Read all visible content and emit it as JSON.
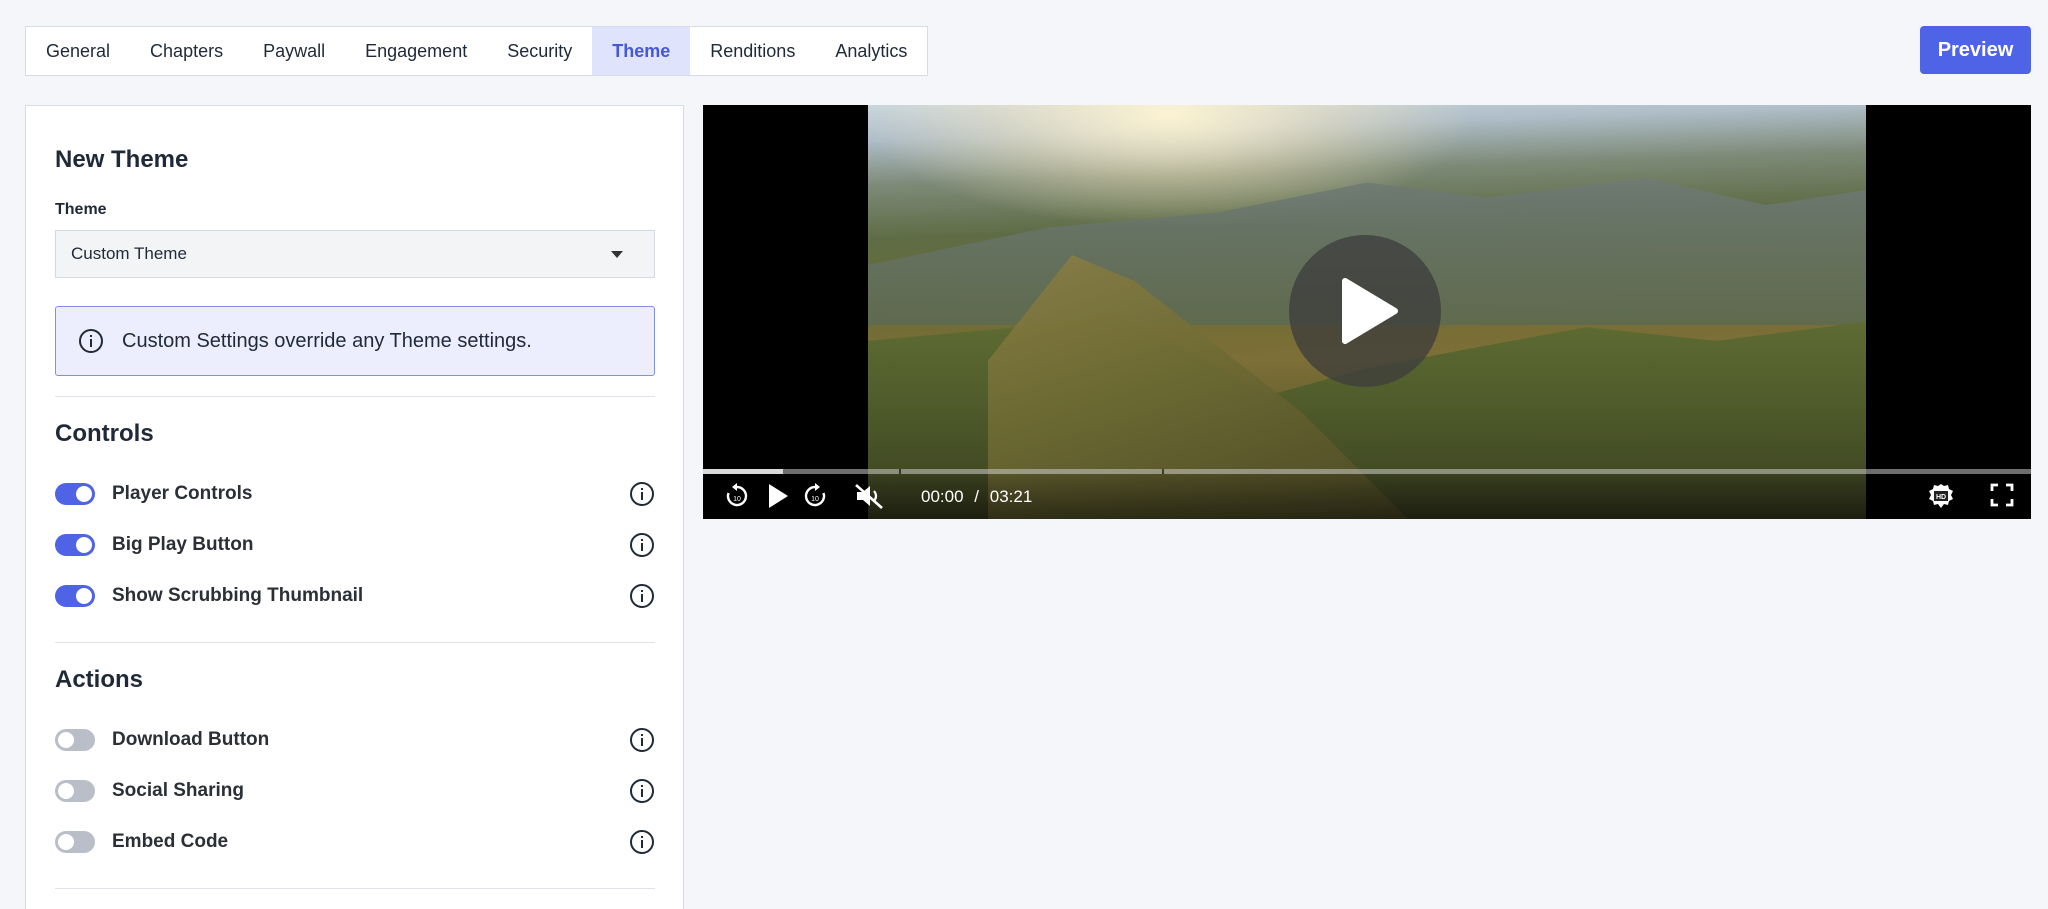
{
  "tabs": [
    {
      "label": "General"
    },
    {
      "label": "Chapters"
    },
    {
      "label": "Paywall"
    },
    {
      "label": "Engagement"
    },
    {
      "label": "Security"
    },
    {
      "label": "Theme",
      "active": true
    },
    {
      "label": "Renditions"
    },
    {
      "label": "Analytics"
    }
  ],
  "header": {
    "preview_label": "Preview"
  },
  "panel": {
    "title": "New Theme",
    "theme_label": "Theme",
    "theme_value": "Custom Theme",
    "info_text": "Custom Settings override any Theme settings.",
    "controls": {
      "title": "Controls",
      "items": [
        {
          "label": "Player Controls",
          "enabled": true
        },
        {
          "label": "Big Play Button",
          "enabled": true
        },
        {
          "label": "Show Scrubbing Thumbnail",
          "enabled": true
        }
      ]
    },
    "actions": {
      "title": "Actions",
      "items": [
        {
          "label": "Download Button",
          "enabled": false
        },
        {
          "label": "Social Sharing",
          "enabled": false
        },
        {
          "label": "Embed Code",
          "enabled": false
        }
      ]
    }
  },
  "player": {
    "current_time": "00:00",
    "separator": "/",
    "duration": "03:21",
    "buffered_fraction": 0.06
  },
  "colors": {
    "accent": "#4f63e6",
    "tab_active_bg": "#dfe3fb",
    "info_bg": "#eceefd",
    "info_border": "#7f8cf0",
    "toggle_off": "#b9bec8"
  }
}
